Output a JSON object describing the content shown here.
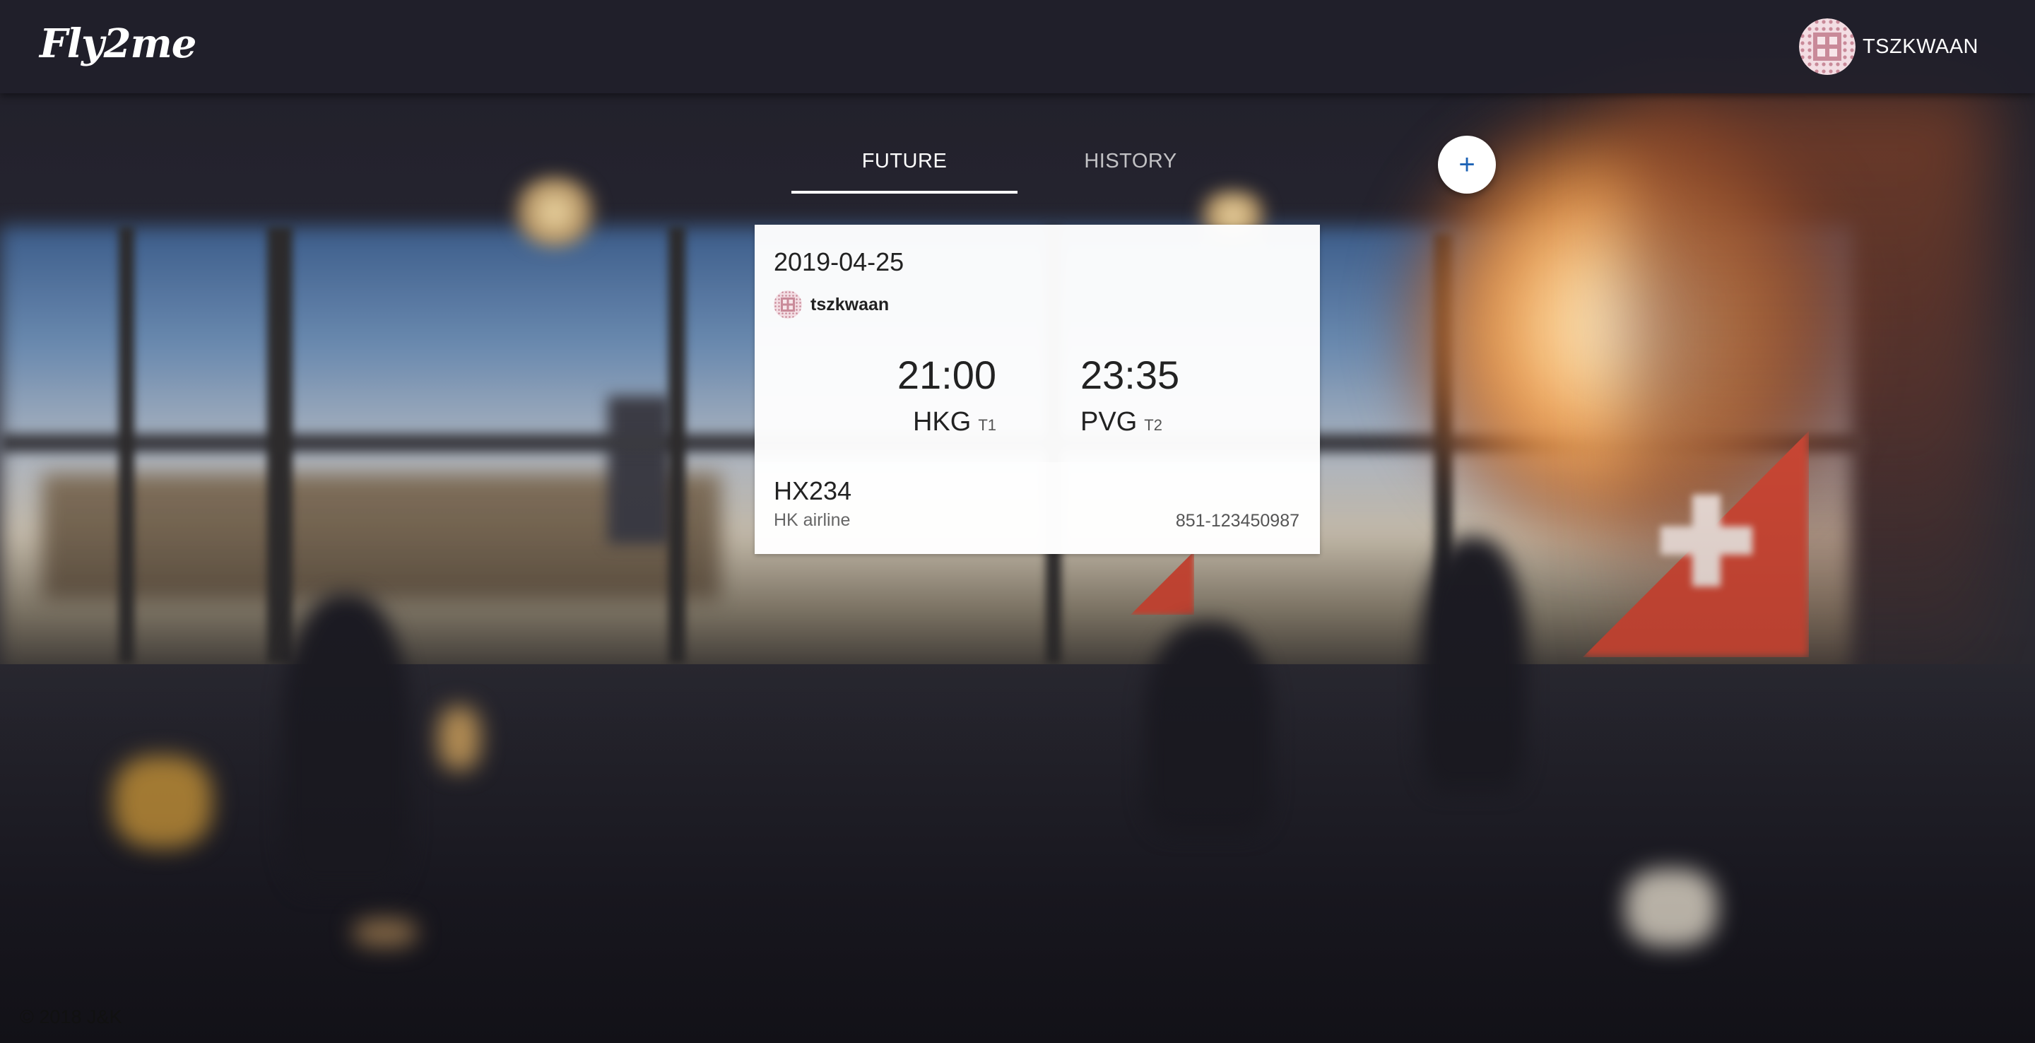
{
  "header": {
    "logo": "Fly2me",
    "username": "TSZKWAAN"
  },
  "tabs": [
    {
      "label": "FUTURE",
      "active": true
    },
    {
      "label": "HISTORY",
      "active": false
    }
  ],
  "add_button_symbol": "+",
  "flight_card": {
    "date": "2019-04-25",
    "user": "tszkwaan",
    "departure": {
      "time": "21:00",
      "airport": "HKG",
      "terminal": "T1"
    },
    "arrival": {
      "time": "23:35",
      "airport": "PVG",
      "terminal": "T2"
    },
    "flight_number": "HX234",
    "airline": "HK airline",
    "booking_number": "851-123450987"
  },
  "footer": "© 2018 J&K",
  "colors": {
    "header_bg": "#21202a",
    "accent_blue": "#1e63b6",
    "avatar_pink": "#c98a99"
  },
  "icons": {
    "avatar": "user-avatar-pattern",
    "add": "plus-icon"
  }
}
